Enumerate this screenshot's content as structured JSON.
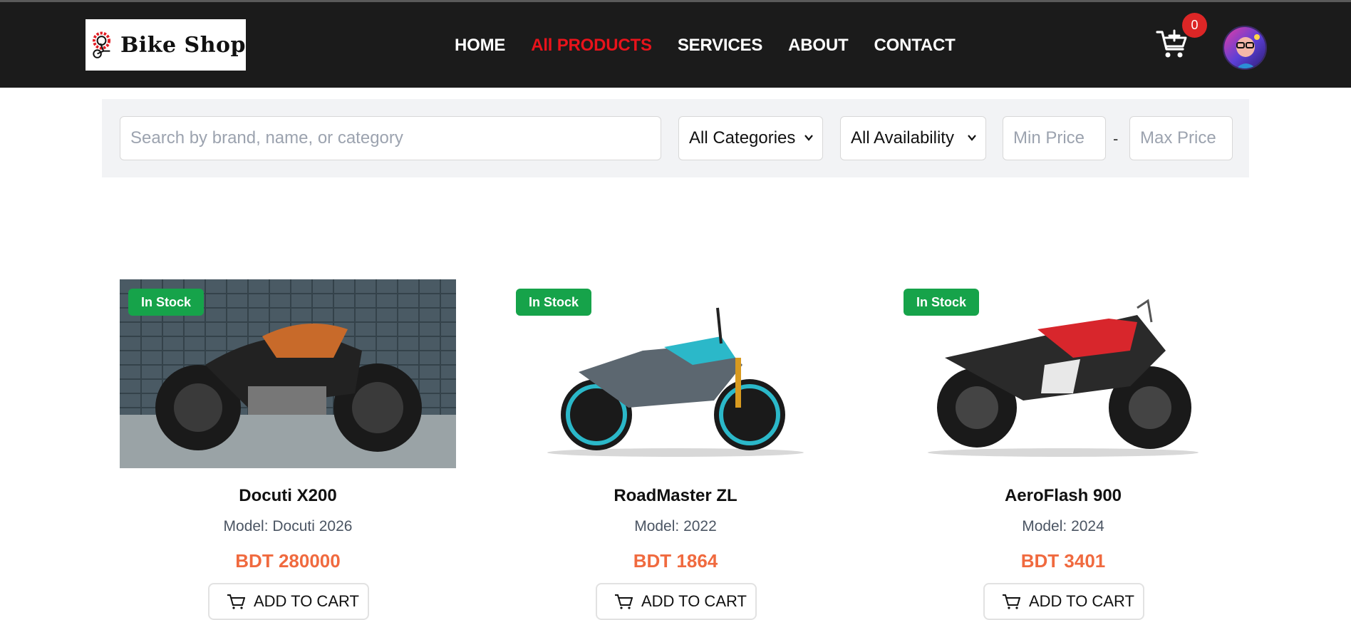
{
  "header": {
    "logo_text": "Bike Shop",
    "nav": [
      {
        "label": "HOME",
        "active": false
      },
      {
        "label": "All PRODUCTS",
        "active": true
      },
      {
        "label": "SERVICES",
        "active": false
      },
      {
        "label": "ABOUT",
        "active": false
      },
      {
        "label": "CONTACT",
        "active": false
      }
    ],
    "cart_count": "0",
    "cart_icon": "cart-plus-icon",
    "avatar_icon": "user-avatar"
  },
  "filters": {
    "search_placeholder": "Search by brand, name, or category",
    "category_selected": "All Categories",
    "availability_selected": "All Availability",
    "min_price_placeholder": "Min Price",
    "price_separator": "-",
    "max_price_placeholder": "Max Price"
  },
  "products": [
    {
      "badge": "In Stock",
      "name": "Docuti X200",
      "model": "Model: Docuti 2026",
      "price": "BDT 280000",
      "add_label": "ADD TO CART"
    },
    {
      "badge": "In Stock",
      "name": "RoadMaster ZL",
      "model": "Model: 2022",
      "price": "BDT 1864",
      "add_label": "ADD TO CART"
    },
    {
      "badge": "In Stock",
      "name": "AeroFlash 900",
      "model": "Model: 2024",
      "price": "BDT 3401",
      "add_label": "ADD TO CART"
    }
  ],
  "colors": {
    "header_bg": "#1b1b1b",
    "nav_active": "#e8131b",
    "badge_green": "#16a34a",
    "price_orange": "#f06a3f",
    "cart_badge": "#dc2626"
  }
}
